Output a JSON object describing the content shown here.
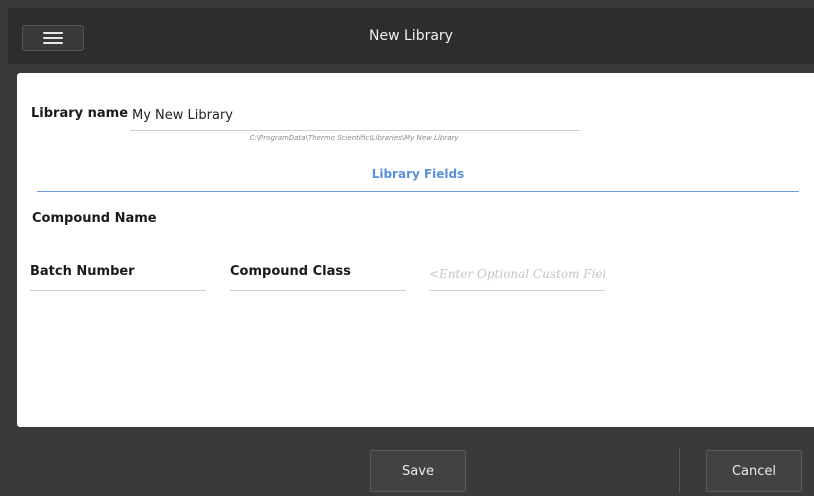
{
  "header": {
    "title": "New Library",
    "menu_icon": "hamburger-menu-icon"
  },
  "library": {
    "name_label": "Library name",
    "name_value": "My New Library",
    "path": "C:\\ProgramData\\Thermo Scientific\\Libraries\\My New Library"
  },
  "fields": {
    "section_title": "Library Fields",
    "compound_name": "Compound Name",
    "batch_number": "Batch Number",
    "compound_class": "Compound Class",
    "custom_placeholder": "<Enter Optional Custom Field>"
  },
  "footer": {
    "save_label": "Save",
    "cancel_label": "Cancel"
  },
  "colors": {
    "accent": "#5b8fd8",
    "bar_bg": "#2d2d2d"
  }
}
